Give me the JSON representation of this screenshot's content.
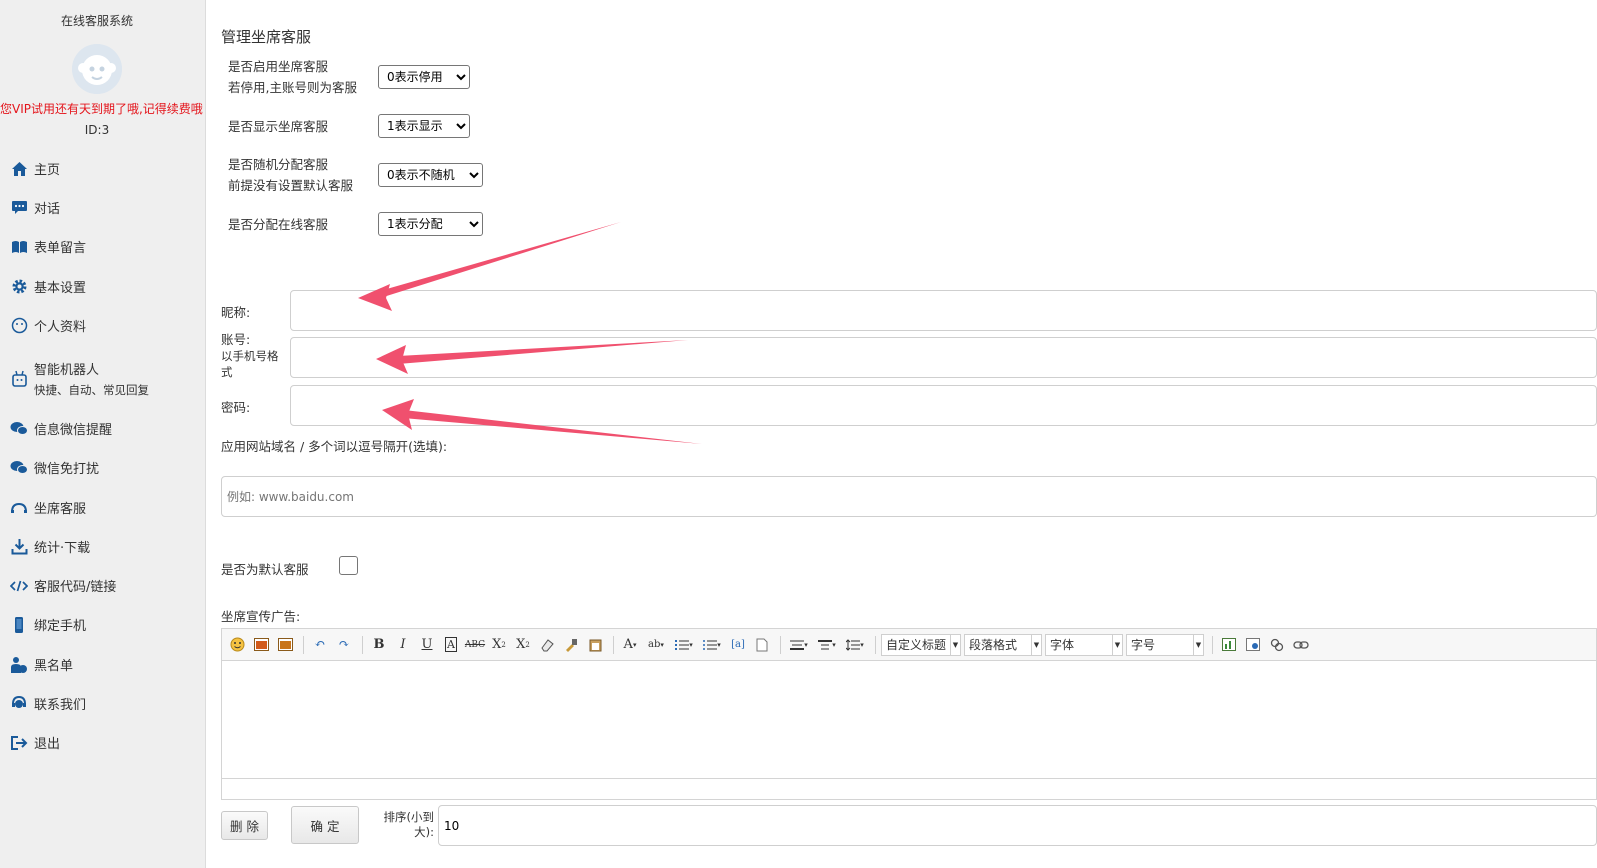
{
  "sidebar": {
    "title": "在线客服系统",
    "vip_notice": "您VIP试用还有天到期了哦,记得续费哦",
    "user_id": "ID:3",
    "items": [
      {
        "label": "主页",
        "icon": "home-icon"
      },
      {
        "label": "对话",
        "icon": "chat-icon"
      },
      {
        "label": "表单留言",
        "icon": "book-icon"
      },
      {
        "label": "基本设置",
        "icon": "gear-icon"
      },
      {
        "label": "个人资料",
        "icon": "user-profile-icon"
      },
      {
        "label": "智能机器人",
        "sub": "快捷、自动、常见回复",
        "icon": "robot-icon"
      },
      {
        "label": "信息微信提醒",
        "icon": "wechat-icon"
      },
      {
        "label": "微信免打扰",
        "icon": "wechat-mute-icon"
      },
      {
        "label": "坐席客服",
        "icon": "headset-icon"
      },
      {
        "label": "统计·下载",
        "icon": "download-icon"
      },
      {
        "label": "客服代码/链接",
        "icon": "code-icon"
      },
      {
        "label": "绑定手机",
        "icon": "phone-icon"
      },
      {
        "label": "黑名单",
        "icon": "blacklist-icon"
      },
      {
        "label": "联系我们",
        "icon": "contact-icon"
      },
      {
        "label": "退出",
        "icon": "logout-icon"
      }
    ]
  },
  "main": {
    "title": "管理坐席客服",
    "settings": [
      {
        "label1": "是否启用坐席客服",
        "label2": "若停用,主账号则为客服",
        "value": "0表示停用"
      },
      {
        "label1": "是否显示坐席客服",
        "label2": "",
        "value": "1表示显示"
      },
      {
        "label1": "是否随机分配客服",
        "label2": "前提没有设置默认客服",
        "value": "0表示不随机"
      },
      {
        "label1": "是否分配在线客服",
        "label2": "",
        "value": "1表示分配"
      }
    ],
    "nickname_label": "昵称:",
    "account_label": "账号:",
    "account_hint1": "以手机号格",
    "account_hint2": "式",
    "password_label": "密码:",
    "domain_label": "应用网站域名 / 多个词以逗号隔开(选填):",
    "domain_placeholder": "例如: www.baidu.com",
    "default_label": "是否为默认客服",
    "ad_label": "坐席宣传广告:",
    "editor": {
      "custom_title": "自定义标题",
      "paragraph": "段落格式",
      "font": "字体",
      "size": "字号"
    },
    "delete_button": "删 除",
    "confirm_button": "确 定",
    "sort_label1": "排序(小到",
    "sort_label2": "大):",
    "sort_value": "10"
  },
  "colors": {
    "accent_red": "#e4141b",
    "arrow": "#f0506e",
    "sidebar_bg": "#efefef"
  }
}
